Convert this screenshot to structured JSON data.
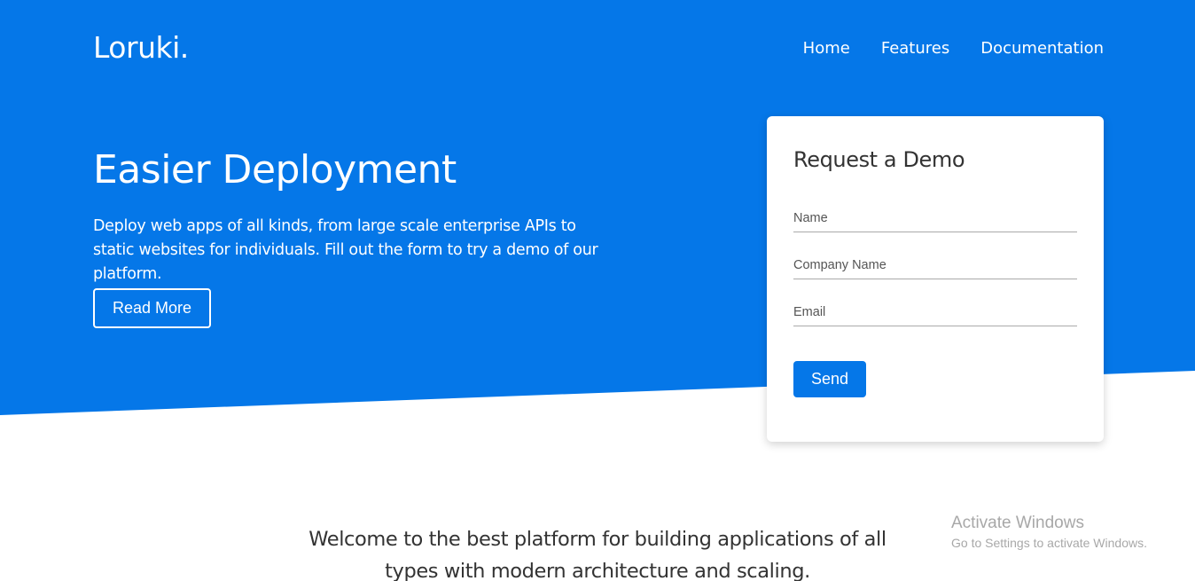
{
  "brand": {
    "logo": "Loruki.",
    "primary_color": "#0577e8"
  },
  "nav": {
    "items": [
      "Home",
      "Features",
      "Documentation"
    ]
  },
  "hero": {
    "title": "Easier Deployment",
    "text": "Deploy web apps of all kinds, from large scale enterprise APIs to static websites for individuals. Fill out the form to try a demo of our platform.",
    "button_label": "Read More"
  },
  "demo_form": {
    "title": "Request a Demo",
    "name_placeholder": "Name",
    "company_placeholder": "Company Name",
    "email_placeholder": "Email",
    "send_label": "Send"
  },
  "welcome": {
    "text": "Welcome to the best platform for building applications of all types with modern architecture and scaling."
  },
  "os_watermark": {
    "title": "Activate Windows",
    "subtitle": "Go to Settings to activate Windows."
  }
}
